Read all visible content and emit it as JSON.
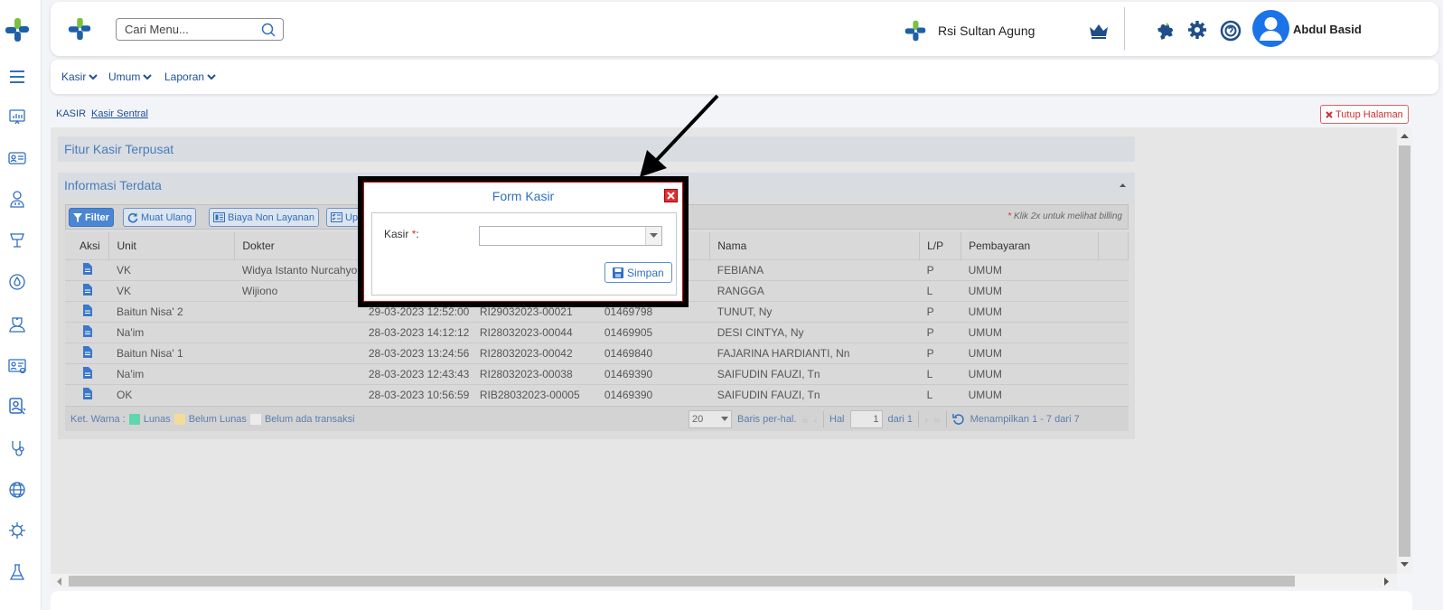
{
  "header": {
    "search_placeholder": "Cari Menu...",
    "org_name": "Rsi Sultan Agung",
    "user_name": "Abdul Basid"
  },
  "menu": [
    {
      "label": "Kasir"
    },
    {
      "label": "Umum"
    },
    {
      "label": "Laporan"
    }
  ],
  "breadcrumb": {
    "root": "KASIR",
    "current": "Kasir Sentral"
  },
  "close_page_label": "Tutup Halaman",
  "panels": {
    "feature_title": "Fitur Kasir Terpusat",
    "info_title": "Informasi Terdata"
  },
  "toolbar": {
    "filter": "Filter",
    "reload": "Muat Ulang",
    "non_service_fee": "Biaya Non Layanan",
    "partial": "Up",
    "note_star": "*",
    "note": "Klik 2x untuk melihat billing"
  },
  "table": {
    "headers": {
      "aksi": "Aksi",
      "unit": "Unit",
      "dokter": "Dokter",
      "nama": "Nama",
      "lp": "L/P",
      "pembayaran": "Pembayaran"
    },
    "rows": [
      {
        "unit": "VK",
        "dokter": "Widya Istanto Nurcahyo",
        "tanggal": "",
        "no_reg": "",
        "no_rm": "",
        "nama": "FEBIANA",
        "lp": "P",
        "pembayaran": "UMUM"
      },
      {
        "unit": "VK",
        "dokter": "Wijiono",
        "tanggal": "",
        "no_reg": "",
        "no_rm": "",
        "nama": "RANGGA",
        "lp": "L",
        "pembayaran": "UMUM"
      },
      {
        "unit": "Baitun Nisa' 2",
        "dokter": "",
        "tanggal": "29-03-2023 12:52:00",
        "no_reg": "RI29032023-00021",
        "no_rm": "01469798",
        "nama": "TUNUT, Ny",
        "lp": "P",
        "pembayaran": "UMUM"
      },
      {
        "unit": "Na'im",
        "dokter": "",
        "tanggal": "28-03-2023 14:12:12",
        "no_reg": "RI28032023-00044",
        "no_rm": "01469905",
        "nama": "DESI CINTYA, Ny",
        "lp": "P",
        "pembayaran": "UMUM"
      },
      {
        "unit": "Baitun Nisa' 1",
        "dokter": "",
        "tanggal": "28-03-2023 13:24:56",
        "no_reg": "RI28032023-00042",
        "no_rm": "01469840",
        "nama": "FAJARINA HARDIANTI, Nn",
        "lp": "P",
        "pembayaran": "UMUM"
      },
      {
        "unit": "Na'im",
        "dokter": "",
        "tanggal": "28-03-2023 12:43:43",
        "no_reg": "RI28032023-00038",
        "no_rm": "01469390",
        "nama": "SAIFUDIN FAUZI, Tn",
        "lp": "L",
        "pembayaran": "UMUM"
      },
      {
        "unit": "OK",
        "dokter": "",
        "tanggal": "28-03-2023 10:56:59",
        "no_reg": "RIB28032023-00005",
        "no_rm": "01469390",
        "nama": "SAIFUDIN FAUZI, Tn",
        "lp": "L",
        "pembayaran": "UMUM"
      }
    ]
  },
  "legend": {
    "title": "Ket. Warna :",
    "items": [
      {
        "label": "Lunas",
        "color": "#5fd6b0"
      },
      {
        "label": "Belum Lunas",
        "color": "#f3dc9a"
      },
      {
        "label": "Belum ada transaksi",
        "color": "#ececec"
      }
    ]
  },
  "pager": {
    "page_size": "20",
    "rows_per_page": "Baris per-hal.",
    "page_label": "Hal",
    "page": "1",
    "of_label": "dari 1",
    "showing": "Menampilkan 1 - 7 dari 7"
  },
  "dialog": {
    "title": "Form Kasir",
    "field_label": "Kasir",
    "required_mark": "*",
    "field_colon": ":",
    "field_value": "",
    "save_label": "Simpan"
  },
  "colors": {
    "accent": "#2f6fc0",
    "danger": "#d03030"
  }
}
